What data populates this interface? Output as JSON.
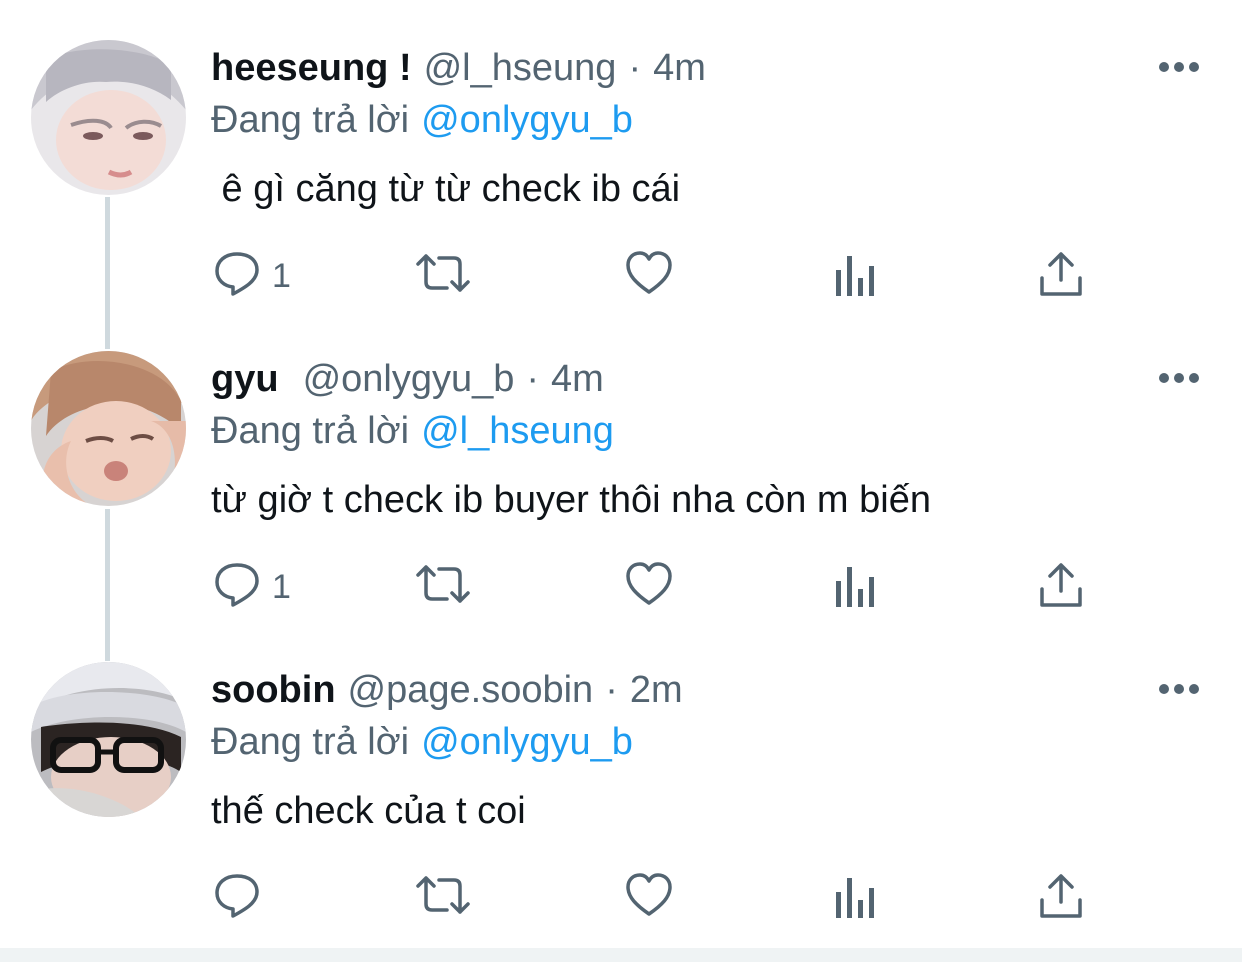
{
  "tweets": [
    {
      "name": "heeseung !",
      "handle": "@l_hseung",
      "separator": "·",
      "time": "4m",
      "reply_prefix": "Đang trả lời",
      "reply_to": "@onlygyu_b",
      "text": " ê gì căng từ từ check ib cái",
      "reply_count": "1"
    },
    {
      "name": "gyu",
      "handle": "@onlygyu_b",
      "separator": "·",
      "time": "4m",
      "reply_prefix": "Đang trả lời",
      "reply_to": "@l_hseung",
      "text": "từ giờ t check ib buyer thôi nha còn m biến",
      "reply_count": "1"
    },
    {
      "name": "soobin",
      "handle": "@page.soobin",
      "separator": "·",
      "time": "2m",
      "reply_prefix": "Đang trả lời",
      "reply_to": "@onlygyu_b",
      "text": "thế check của t coi",
      "reply_count": ""
    }
  ],
  "icons": {
    "more": "more-horizontal-icon",
    "reply": "reply-bubble-icon",
    "retweet": "retweet-icon",
    "like": "heart-icon",
    "views": "views-chart-icon",
    "share": "share-upload-icon"
  },
  "colors": {
    "text": "#0f1419",
    "secondary": "#536471",
    "link": "#1d9bf0",
    "thread_line": "#cfd9de"
  }
}
